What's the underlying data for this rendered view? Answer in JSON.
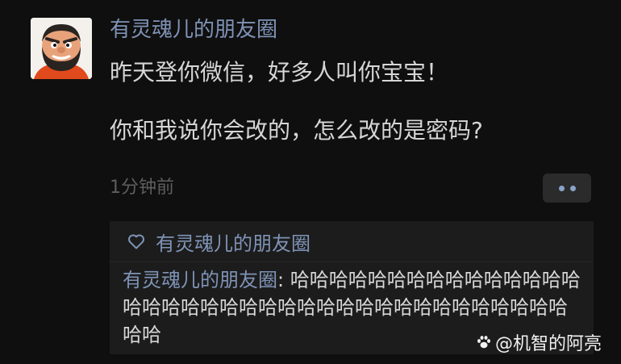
{
  "post": {
    "username": "有灵魂儿的朋友圈",
    "content_line1": "昨天登你微信，好多人叫你宝宝！",
    "content_line2": "你和我说你会改的，怎么改的是密码?",
    "timestamp": "1分钟前"
  },
  "interactions": {
    "likes": [
      "有灵魂儿的朋友圈"
    ],
    "comments": [
      {
        "author": "有灵魂儿的朋友圈",
        "separator": ": ",
        "text": "哈哈哈哈哈哈哈哈哈哈哈哈哈哈哈哈哈哈哈哈哈哈哈哈哈哈哈哈哈哈哈哈哈哈哈哈哈哈哈哈"
      }
    ]
  },
  "watermark": {
    "text": "@机智的阿亮"
  },
  "colors": {
    "background": "#0f0f0f",
    "name_link": "#7f93b6",
    "body_text": "#d6d6d6",
    "muted_text": "#5e5e5e",
    "panel_bg": "#1c1c1c"
  },
  "icons": {
    "avatar": "cartoon-bearded-man-avatar",
    "more": "more-dots-icon",
    "like": "heart-outline-icon",
    "watermark": "paw-icon"
  }
}
